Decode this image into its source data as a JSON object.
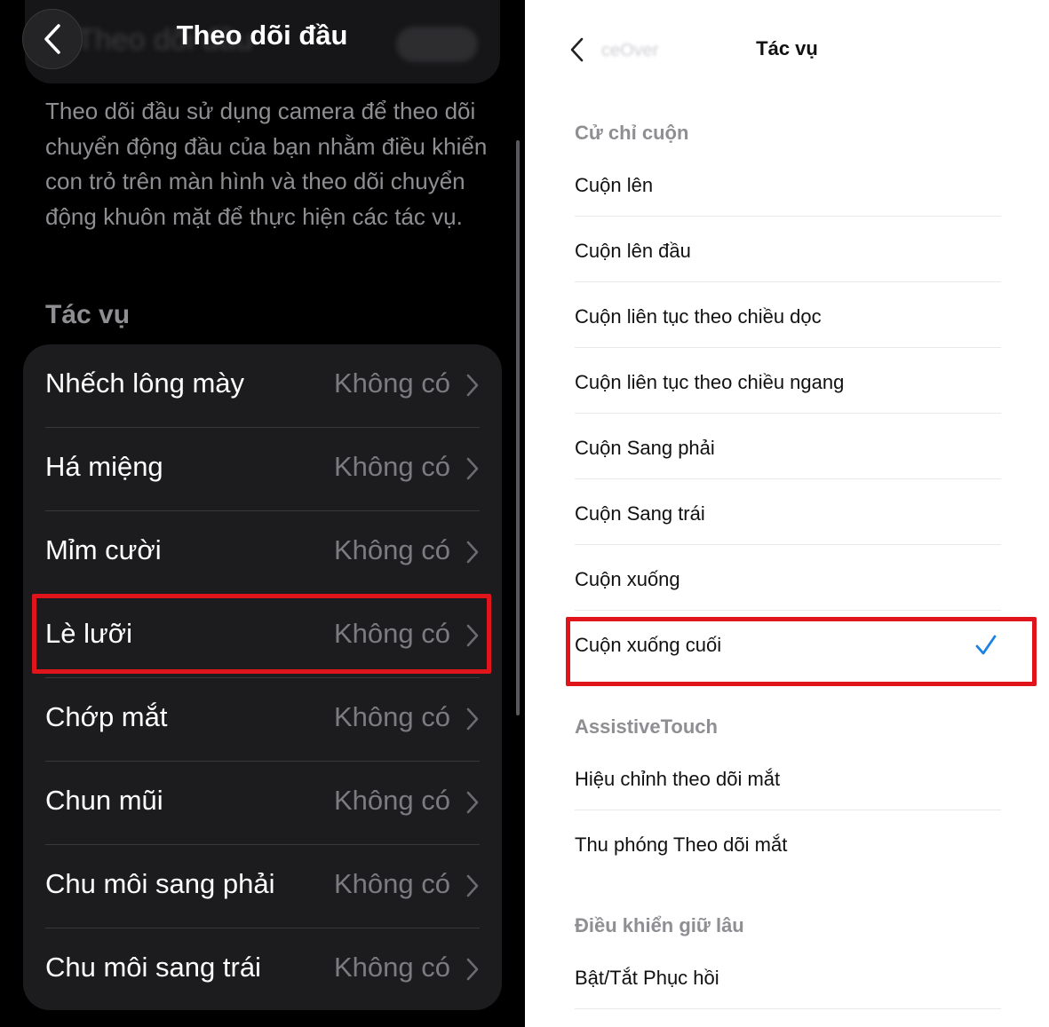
{
  "left": {
    "title": "Theo dõi đầu",
    "ghost_title": "Theo dõi đầu",
    "description": "Theo dõi đầu sử dụng camera để theo dõi chuyển động đầu của bạn nhằm điều khiển con trỏ trên màn hình và theo dõi chuyển động khuôn mặt để thực hiện các tác vụ.",
    "section_label": "Tác vụ",
    "rows": [
      {
        "label": "Nhếch lông mày",
        "value": "Không có"
      },
      {
        "label": "Há miệng",
        "value": "Không có"
      },
      {
        "label": "Mỉm cười",
        "value": "Không có"
      },
      {
        "label": "Lè lưỡi",
        "value": "Không có"
      },
      {
        "label": "Chớp mắt",
        "value": "Không có"
      },
      {
        "label": "Chun mũi",
        "value": "Không có"
      },
      {
        "label": "Chu môi sang phải",
        "value": "Không có"
      },
      {
        "label": "Chu môi sang trái",
        "value": "Không có"
      }
    ],
    "highlight_color": "#e0141b"
  },
  "right": {
    "title": "Tác vụ",
    "back_ghost": "ceOver",
    "sections": [
      {
        "label": "Cử chỉ cuộn"
      },
      {
        "label": "AssistiveTouch"
      },
      {
        "label": "Điều khiển giữ lâu"
      }
    ],
    "items": [
      {
        "label": "Cuộn lên"
      },
      {
        "label": "Cuộn lên đầu"
      },
      {
        "label": "Cuộn liên tục theo chiều dọc"
      },
      {
        "label": "Cuộn liên tục theo chiều ngang"
      },
      {
        "label": "Cuộn Sang phải"
      },
      {
        "label": "Cuộn Sang trái"
      },
      {
        "label": "Cuộn xuống"
      },
      {
        "label": "Cuộn xuống cuối",
        "selected": true
      },
      {
        "label": "Hiệu chỉnh theo dõi mắt"
      },
      {
        "label": "Thu phóng Theo dõi mắt"
      },
      {
        "label": "Bật/Tắt Phục hồi"
      }
    ],
    "check_color": "#1a82e2"
  },
  "icons": {
    "back": "chevron-left-icon",
    "disclosure": "chevron-right-icon",
    "check": "checkmark-icon"
  }
}
